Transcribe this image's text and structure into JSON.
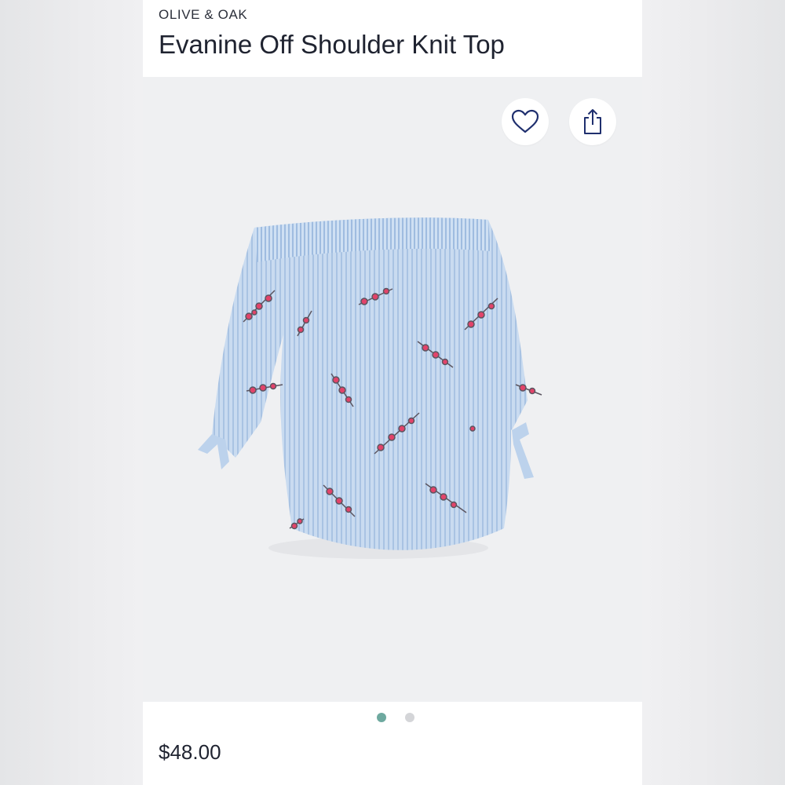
{
  "product": {
    "brand": "OLIVE & OAK",
    "title": "Evanine Off Shoulder Knit Top",
    "price": "$48.00"
  },
  "actions": {
    "favorite_icon": "heart-icon",
    "share_icon": "share-icon"
  },
  "gallery": {
    "image_count": 2,
    "active_index": 0
  },
  "colors": {
    "accent_dot": "#6ea99f",
    "inactive_dot": "#d4d5d8",
    "text_dark": "#1f2330",
    "hero_bg": "#eff0f2"
  }
}
